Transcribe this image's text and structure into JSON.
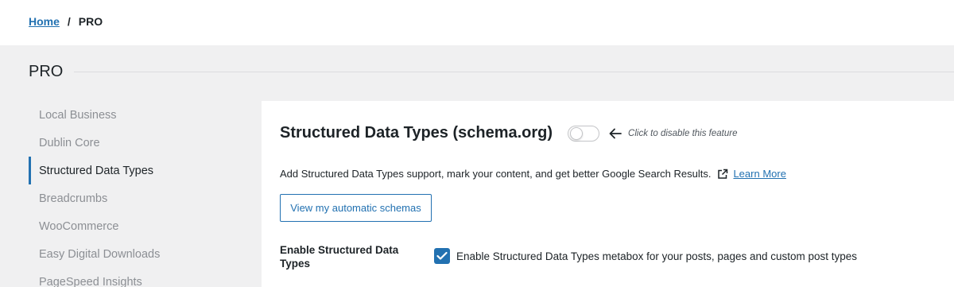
{
  "breadcrumb": {
    "home": "Home",
    "separator": "/",
    "current": "PRO"
  },
  "page": {
    "title": "PRO"
  },
  "sidebar": {
    "items": [
      {
        "label": "Local Business",
        "active": false
      },
      {
        "label": "Dublin Core",
        "active": false
      },
      {
        "label": "Structured Data Types",
        "active": true
      },
      {
        "label": "Breadcrumbs",
        "active": false
      },
      {
        "label": "WooCommerce",
        "active": false
      },
      {
        "label": "Easy Digital Downloads",
        "active": false
      },
      {
        "label": "PageSpeed Insights",
        "active": false
      }
    ]
  },
  "main": {
    "section_title": "Structured Data Types (schema.org)",
    "toggle_enabled": false,
    "toggle_hint": "Click to disable this feature",
    "description": "Add Structured Data Types support, mark your content, and get better Google Search Results.",
    "learn_more": "Learn More",
    "view_button": "View my automatic schemas",
    "field_label": "Enable Structured Data Types",
    "checkbox_checked": true,
    "checkbox_label": "Enable Structured Data Types metabox for your posts, pages and custom post types"
  },
  "colors": {
    "accent": "#2271b1",
    "text": "#1d2327",
    "muted": "#8c8f94",
    "background": "#f0f0f1"
  },
  "icons": [
    "arrow-left-icon",
    "external-link-icon",
    "checkmark-icon"
  ]
}
